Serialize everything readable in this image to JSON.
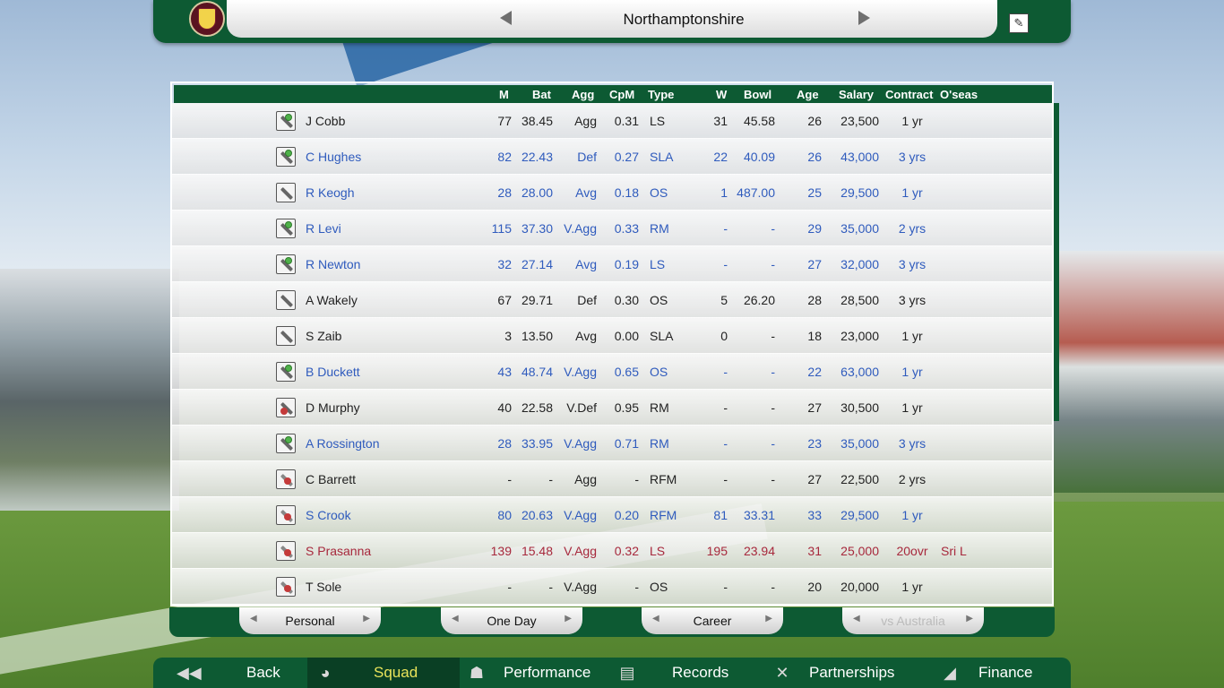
{
  "header": {
    "team_name": "Northamptonshire"
  },
  "columns": [
    "M",
    "Bat",
    "Agg",
    "CpM",
    "Type",
    "W",
    "Bowl",
    "Age",
    "Salary",
    "Contract",
    "O'seas"
  ],
  "players": [
    {
      "role": "bat-star",
      "color": "black",
      "name": "J Cobb",
      "m": "77",
      "bat": "38.45",
      "agg": "Agg",
      "cpm": "0.31",
      "type": "LS",
      "w": "31",
      "bowl": "45.58",
      "age": "26",
      "salary": "23,500",
      "contract": "1 yr",
      "oseas": ""
    },
    {
      "role": "bat-star",
      "color": "blue",
      "name": "C Hughes",
      "m": "82",
      "bat": "22.43",
      "agg": "Def",
      "cpm": "0.27",
      "type": "SLA",
      "w": "22",
      "bowl": "40.09",
      "age": "26",
      "salary": "43,000",
      "contract": "3 yrs",
      "oseas": ""
    },
    {
      "role": "bat",
      "color": "blue",
      "name": "R Keogh",
      "m": "28",
      "bat": "28.00",
      "agg": "Avg",
      "cpm": "0.18",
      "type": "OS",
      "w": "1",
      "bowl": "487.00",
      "age": "25",
      "salary": "29,500",
      "contract": "1 yr",
      "oseas": ""
    },
    {
      "role": "bat-star",
      "color": "blue",
      "name": "R Levi",
      "m": "115",
      "bat": "37.30",
      "agg": "V.Agg",
      "cpm": "0.33",
      "type": "RM",
      "w": "-",
      "bowl": "-",
      "age": "29",
      "salary": "35,000",
      "contract": "2 yrs",
      "oseas": ""
    },
    {
      "role": "bat-star",
      "color": "blue",
      "name": "R Newton",
      "m": "32",
      "bat": "27.14",
      "agg": "Avg",
      "cpm": "0.19",
      "type": "LS",
      "w": "-",
      "bowl": "-",
      "age": "27",
      "salary": "32,000",
      "contract": "3 yrs",
      "oseas": ""
    },
    {
      "role": "bat",
      "color": "black",
      "name": "A Wakely",
      "m": "67",
      "bat": "29.71",
      "agg": "Def",
      "cpm": "0.30",
      "type": "OS",
      "w": "5",
      "bowl": "26.20",
      "age": "28",
      "salary": "28,500",
      "contract": "3 yrs",
      "oseas": ""
    },
    {
      "role": "bat",
      "color": "black",
      "name": "S Zaib",
      "m": "3",
      "bat": "13.50",
      "agg": "Avg",
      "cpm": "0.00",
      "type": "SLA",
      "w": "0",
      "bowl": "-",
      "age": "18",
      "salary": "23,000",
      "contract": "1 yr",
      "oseas": ""
    },
    {
      "role": "bat-star",
      "color": "blue",
      "name": "B Duckett",
      "m": "43",
      "bat": "48.74",
      "agg": "V.Agg",
      "cpm": "0.65",
      "type": "OS",
      "w": "-",
      "bowl": "-",
      "age": "22",
      "salary": "63,000",
      "contract": "1 yr",
      "oseas": ""
    },
    {
      "role": "keeper",
      "color": "black",
      "name": "D Murphy",
      "m": "40",
      "bat": "22.58",
      "agg": "V.Def",
      "cpm": "0.95",
      "type": "RM",
      "w": "-",
      "bowl": "-",
      "age": "27",
      "salary": "30,500",
      "contract": "1 yr",
      "oseas": ""
    },
    {
      "role": "bat-star",
      "color": "blue",
      "name": "A Rossington",
      "m": "28",
      "bat": "33.95",
      "agg": "V.Agg",
      "cpm": "0.71",
      "type": "RM",
      "w": "-",
      "bowl": "-",
      "age": "23",
      "salary": "35,000",
      "contract": "3 yrs",
      "oseas": ""
    },
    {
      "role": "bowl",
      "color": "black",
      "name": "C Barrett",
      "m": "-",
      "bat": "-",
      "agg": "Agg",
      "cpm": "-",
      "type": "RFM",
      "w": "-",
      "bowl": "-",
      "age": "27",
      "salary": "22,500",
      "contract": "2 yrs",
      "oseas": ""
    },
    {
      "role": "bowl",
      "color": "blue",
      "name": "S Crook",
      "m": "80",
      "bat": "20.63",
      "agg": "V.Agg",
      "cpm": "0.20",
      "type": "RFM",
      "w": "81",
      "bowl": "33.31",
      "age": "33",
      "salary": "29,500",
      "contract": "1 yr",
      "oseas": ""
    },
    {
      "role": "bowl",
      "color": "red",
      "name": "S Prasanna",
      "m": "139",
      "bat": "15.48",
      "agg": "V.Agg",
      "cpm": "0.32",
      "type": "LS",
      "w": "195",
      "bowl": "23.94",
      "age": "31",
      "salary": "25,000",
      "contract": "20ovr",
      "oseas": "Sri L"
    },
    {
      "role": "bowl",
      "color": "black",
      "name": "T Sole",
      "m": "-",
      "bat": "-",
      "agg": "V.Agg",
      "cpm": "-",
      "type": "OS",
      "w": "-",
      "bowl": "-",
      "age": "20",
      "salary": "20,000",
      "contract": "1 yr",
      "oseas": ""
    }
  ],
  "tabs": [
    {
      "label": "Personal",
      "enabled": true
    },
    {
      "label": "One Day",
      "enabled": true
    },
    {
      "label": "Career",
      "enabled": true
    },
    {
      "label": "vs Australia",
      "enabled": false
    }
  ],
  "nav": [
    {
      "label": "Back",
      "icon": "back-arrow-icon",
      "active": false
    },
    {
      "label": "Squad",
      "icon": "helmet-icon",
      "active": true
    },
    {
      "label": "Performance",
      "icon": "players-icon",
      "active": false
    },
    {
      "label": "Records",
      "icon": "records-book-icon",
      "active": false
    },
    {
      "label": "Partnerships",
      "icon": "crossed-bats-icon",
      "active": false
    },
    {
      "label": "Finance",
      "icon": "chart-icon",
      "active": false
    }
  ],
  "colors": {
    "green": "#0d5a33",
    "blue_text": "#2f5bbd",
    "red_text": "#a7283c",
    "active_nav": "#e9e35a"
  }
}
